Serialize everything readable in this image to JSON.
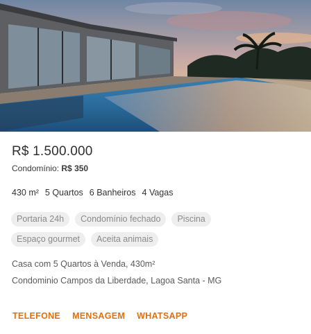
{
  "listing": {
    "price": "R$ 1.500.000",
    "condo_label": "Condomínio:",
    "condo_value": "R$ 350",
    "features": {
      "area": "430 m²",
      "rooms": "5 Quartos",
      "baths": "6 Banheiros",
      "parking": "4 Vagas"
    },
    "tags_row1": [
      "Portaria 24h",
      "Condomínio fechado",
      "Piscina"
    ],
    "tags_row2": [
      "Espaço gourmet",
      "Aceita animais"
    ],
    "description": "Casa com 5 Quartos à Venda, 430m²",
    "address": "Condominio Campos da Liberdade, Lagoa Santa - MG"
  },
  "actions": {
    "phone": "TELEFONE",
    "message": "MENSAGEM",
    "whatsapp": "WHATSAPP"
  },
  "colors": {
    "accent": "#e07010",
    "tag_bg": "#eeeeee",
    "tag_text": "#8a8a8a"
  }
}
